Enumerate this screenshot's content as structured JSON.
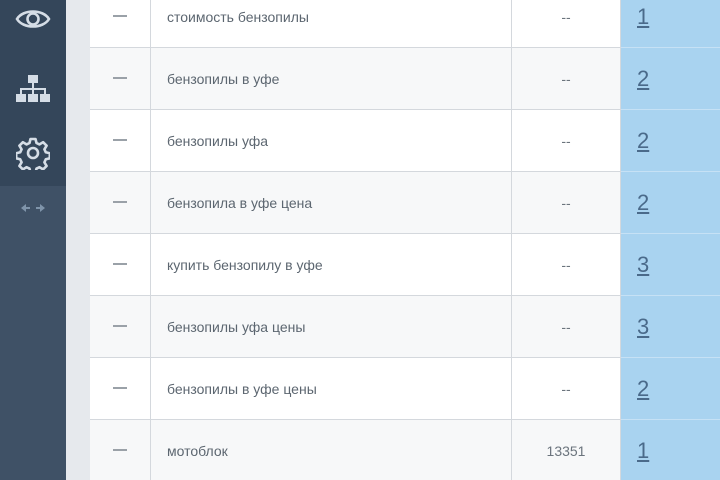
{
  "sidebar": {
    "icons": [
      {
        "name": "eye-icon"
      },
      {
        "name": "sitemap-icon"
      },
      {
        "name": "gear-icon"
      }
    ],
    "collapse_icon": "collapse-arrows-icon"
  },
  "table": {
    "rows": [
      {
        "mark": "—",
        "keyword": "стоимость бензопилы",
        "frequency": "--",
        "position": "1"
      },
      {
        "mark": "—",
        "keyword": "бензопилы в уфе",
        "frequency": "--",
        "position": "2"
      },
      {
        "mark": "—",
        "keyword": "бензопилы уфа",
        "frequency": "--",
        "position": "2"
      },
      {
        "mark": "—",
        "keyword": "бензопила в уфе цена",
        "frequency": "--",
        "position": "2"
      },
      {
        "mark": "—",
        "keyword": "купить бензопилу в уфе",
        "frequency": "--",
        "position": "3"
      },
      {
        "mark": "—",
        "keyword": "бензопилы уфа цены",
        "frequency": "--",
        "position": "3"
      },
      {
        "mark": "—",
        "keyword": "бензопилы в уфе цены",
        "frequency": "--",
        "position": "2"
      },
      {
        "mark": "—",
        "keyword": "мотоблок",
        "frequency": "13351",
        "position": "1"
      }
    ]
  },
  "colors": {
    "sidebar_bg": "#3f5166",
    "sidebar_nav_bg": "#34465a",
    "icon_color": "#d5dde6",
    "position_cell_bg": "#a9d3f0",
    "position_link": "#4a6a8a"
  }
}
